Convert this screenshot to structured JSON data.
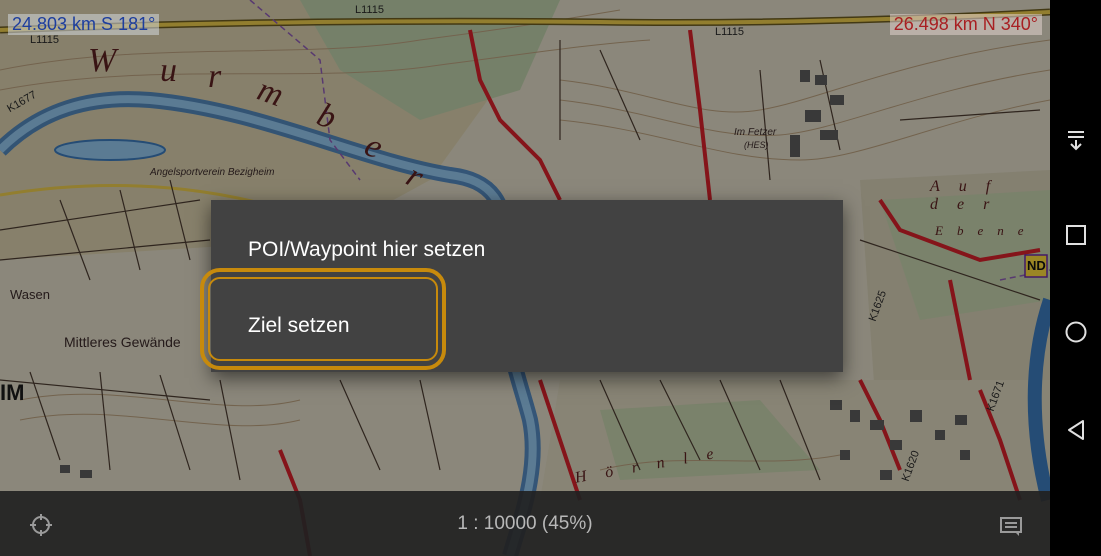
{
  "map": {
    "distance_left": "24.803 km S 181°",
    "distance_right": "26.498 km N 340°",
    "labels": {
      "w": "W",
      "u": "u",
      "r": "r",
      "m": "m",
      "b": "b",
      "e": "e",
      "r2": "r",
      "wasen": "Wasen",
      "mittleres": "Mittleres Gewände",
      "im": "IM",
      "angelsport": "Angelsportverein Bezigheim",
      "im_fetzer": "Im Fetzer",
      "hes": "(HES)",
      "auf_der": "Auf der",
      "ebene": "Ebene",
      "hornle": "Hörnle",
      "nd": "ND",
      "l1115_a": "L1115",
      "l1115_b": "L1115",
      "l1115_c": "L1115",
      "k1620": "K1620",
      "k1625": "K1625",
      "k1677": "K1677",
      "k1671": "K1671"
    }
  },
  "menu": {
    "item_poi": "POI/Waypoint hier setzen",
    "item_ziel": "Ziel setzen"
  },
  "status": {
    "scale": "1 : 10000  (45%)"
  },
  "icons": {
    "crosshair": "crosshair-icon",
    "layers": "layers-icon",
    "collapse": "collapse-icon",
    "recents": "recents-icon",
    "home": "home-icon",
    "back": "back-icon"
  },
  "colors": {
    "menu_bg": "#424242",
    "highlight": "#c78a0c",
    "distance_left": "#1d3e9e",
    "distance_right": "#a81f22",
    "road_red": "#d0202a",
    "river": "#3a78b8"
  }
}
